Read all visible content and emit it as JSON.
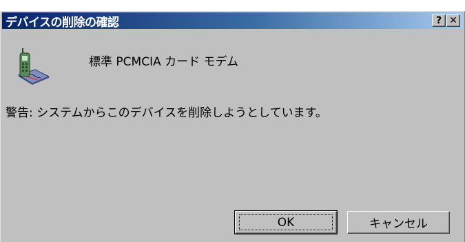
{
  "dialog": {
    "title": "デバイスの削除の確認",
    "help_button": "?",
    "close_button": "✕",
    "device_name": "標準 PCMCIA カード モデム",
    "warning": "警告: システムからこのデバイスを削除しようとしています。",
    "ok_label": "OK",
    "cancel_label": "キャンセル"
  },
  "colors": {
    "title_start": "#0a246a",
    "title_end": "#a6caf0",
    "face": "#c0c0c0"
  },
  "icons": {
    "device": "pcmcia-modem-icon"
  }
}
